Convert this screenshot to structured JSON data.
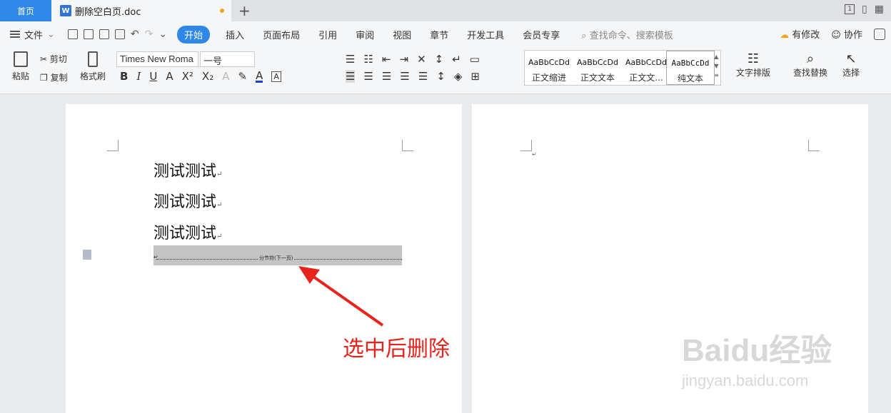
{
  "tabs": {
    "home": "首页",
    "doc_title": "删除空白页.doc",
    "add": "+"
  },
  "window": {
    "page_indicator": "1"
  },
  "menu": {
    "file": "文件",
    "tabs": [
      "开始",
      "插入",
      "页面布局",
      "引用",
      "审阅",
      "视图",
      "章节",
      "开发工具",
      "会员专享"
    ],
    "active_tab": "开始",
    "search": "查找命令、搜索模板",
    "has_changes": "有修改",
    "collab": "协作"
  },
  "ribbon": {
    "paste": "粘贴",
    "cut": "剪切",
    "copy": "复制",
    "format_painter": "格式刷",
    "font_name": "Times New Roma",
    "font_size": "一号",
    "styles": [
      {
        "sample": "AaBbCcDd",
        "label": "正文缩进"
      },
      {
        "sample": "AaBbCcDd",
        "label": "正文文本"
      },
      {
        "sample": "AaBbCcDd",
        "label": "正文文..."
      },
      {
        "sample": "AaBbCcDd",
        "label": "纯文本"
      }
    ],
    "text_layout": "文字排版",
    "find_replace": "查找替换",
    "select": "选择"
  },
  "document": {
    "paragraphs": [
      "测试测试",
      "测试测试",
      "测试测试"
    ],
    "section_break": "分节符(下一页)"
  },
  "annotation": "选中后删除",
  "watermark": {
    "main": "Baidu经验",
    "sub": "jingyan.baidu.com"
  },
  "colors": {
    "accent": "#2f88e8",
    "annotation": "#e8231e",
    "selection": "#c4c4c4"
  }
}
